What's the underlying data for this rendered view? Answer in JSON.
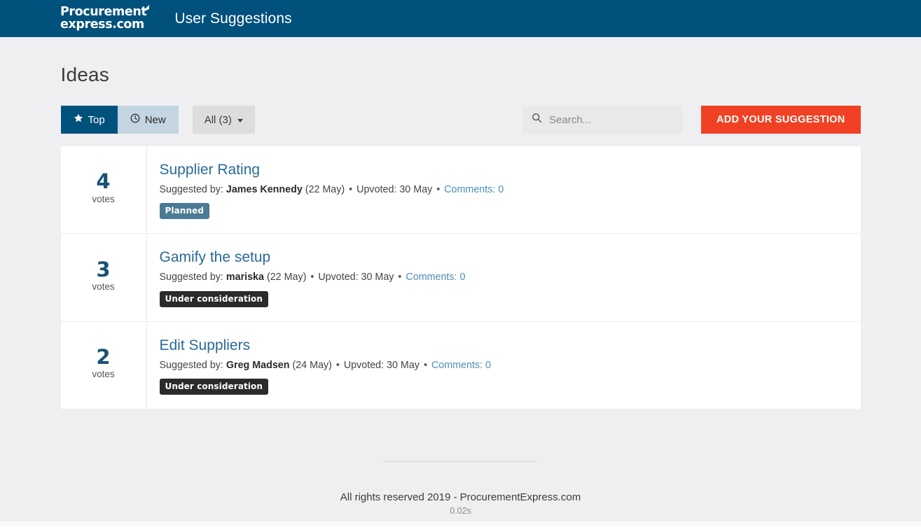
{
  "navbar": {
    "brand_line1": "Procurement",
    "brand_line2": "express.com",
    "brand_swoosh_icon": "swoosh-icon",
    "title": "User Suggestions",
    "background_color": "#00517c"
  },
  "page": {
    "heading": "Ideas",
    "background_color": "#efeff1"
  },
  "toolbar": {
    "tabs": [
      {
        "label": "Top",
        "icon": "star-icon",
        "active": true
      },
      {
        "label": "New",
        "icon": "clock-icon",
        "active": false
      }
    ],
    "filter_dropdown": {
      "label": "All (3)",
      "icon": "chevron-down-icon"
    },
    "search": {
      "placeholder": "Search...",
      "value": "",
      "icon": "search-icon"
    },
    "add_suggestion_label": "ADD YOUR SUGGESTION",
    "add_suggestion_color": "#f04124"
  },
  "ideas": [
    {
      "votes": "4",
      "votes_label": "votes",
      "title": "Supplier Rating",
      "meta_prefix": "Suggested by:",
      "author": "James Kennedy",
      "date": "(22 May)",
      "upvoted": "Upvoted: 30 May",
      "comments": "Comments: 0",
      "badge": "Planned",
      "badge_color": "#4a7a94"
    },
    {
      "votes": "3",
      "votes_label": "votes",
      "title": "Gamify the setup",
      "meta_prefix": "Suggested by:",
      "author": "mariska",
      "date": "(22 May)",
      "upvoted": "Upvoted: 30 May",
      "comments": "Comments: 0",
      "badge": "Under consideration",
      "badge_color": "#2b2b2b"
    },
    {
      "votes": "2",
      "votes_label": "votes",
      "title": "Edit Suppliers",
      "meta_prefix": "Suggested by:",
      "author": "Greg Madsen",
      "date": "(24 May)",
      "upvoted": "Upvoted: 30 May",
      "comments": "Comments: 0",
      "badge": "Under consideration",
      "badge_color": "#2b2b2b"
    }
  ],
  "footer": {
    "copyright": "All rights reserved 2019 - ProcurementExpress.com",
    "render_time": "0.02s"
  },
  "separator": "•"
}
